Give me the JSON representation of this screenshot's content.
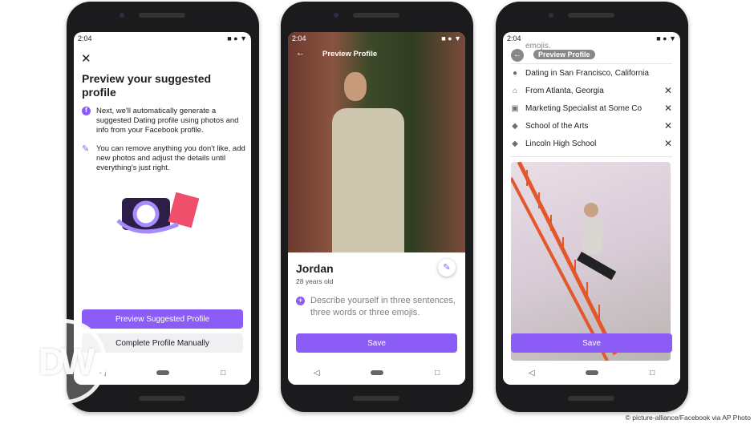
{
  "status_time": "2:04",
  "screen1": {
    "title": "Preview your suggested profile",
    "point1": "Next, we'll automatically generate a suggested Dating profile using photos and info from your Facebook profile.",
    "point2": "You can remove anything you don't like, add new photos and adjust the details until everything's just right.",
    "primary_button": "Preview Suggested Profile",
    "secondary_button": "Complete Profile Manually"
  },
  "screen2": {
    "header": "Preview Profile",
    "name": "Jordan",
    "age": "28 years old",
    "bio_prompt": "Describe yourself in three sentences, three words or three emojis.",
    "save": "Save"
  },
  "screen3": {
    "header": "Preview Profile",
    "overflow_text": "emojis.",
    "details": [
      {
        "icon": "location-pin-icon",
        "label": "Dating in San Francisco, California",
        "removable": false
      },
      {
        "icon": "home-icon",
        "label": "From Atlanta, Georgia",
        "removable": true
      },
      {
        "icon": "briefcase-icon",
        "label": "Marketing Specialist at Some Co",
        "removable": true
      },
      {
        "icon": "graduation-cap-icon",
        "label": "School of the Arts",
        "removable": true
      },
      {
        "icon": "graduation-cap-icon",
        "label": "Lincoln High School",
        "removable": true
      }
    ],
    "save": "Save"
  },
  "logo": "DW",
  "credit": "© picture-alliance/Facebook via AP Photo",
  "colors": {
    "accent": "#8b5cf6"
  }
}
